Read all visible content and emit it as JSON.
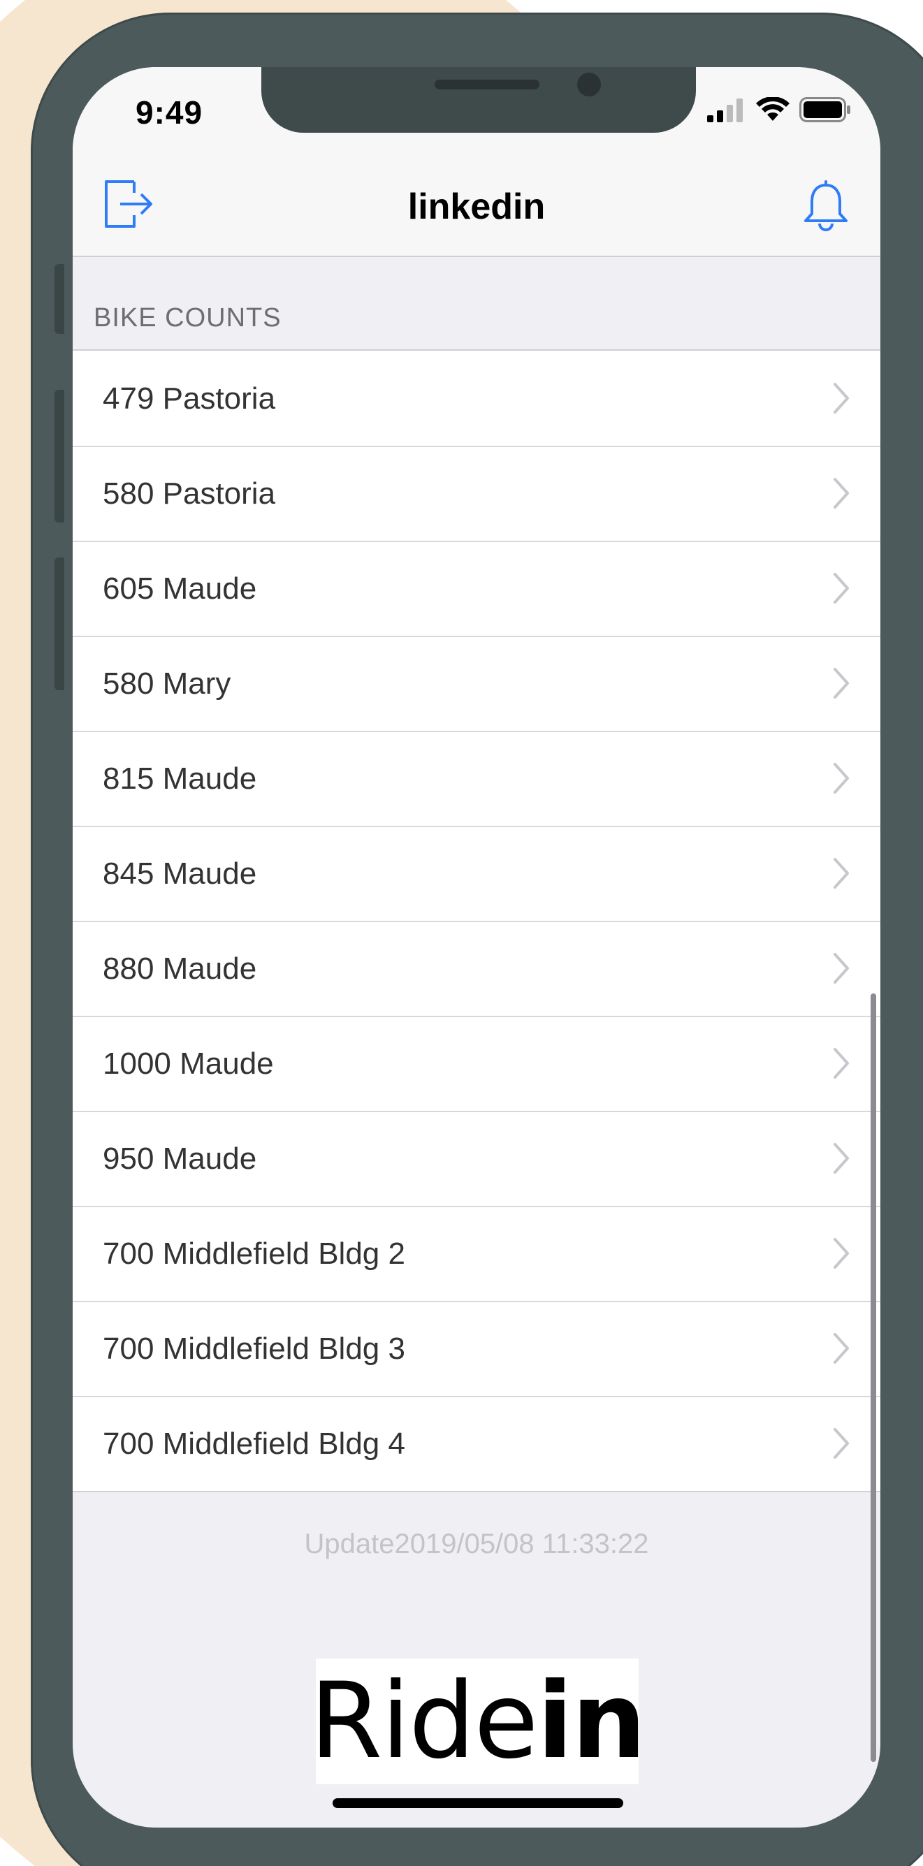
{
  "status_bar": {
    "time": "9:49",
    "icons": [
      "cellular-signal-icon",
      "wifi-icon",
      "battery-icon"
    ]
  },
  "nav": {
    "title": "linkedin",
    "left_icon": "logout-icon",
    "right_icon": "bell-icon",
    "accent_color": "#2f7cf6"
  },
  "section": {
    "header": "BIKE COUNTS"
  },
  "rows": [
    {
      "label": "479 Pastoria"
    },
    {
      "label": "580 Pastoria"
    },
    {
      "label": "605 Maude"
    },
    {
      "label": "580 Mary"
    },
    {
      "label": "815 Maude"
    },
    {
      "label": "845 Maude"
    },
    {
      "label": "880 Maude"
    },
    {
      "label": "1000 Maude"
    },
    {
      "label": "950 Maude"
    },
    {
      "label": "700 Middlefield Bldg 2"
    },
    {
      "label": "700 Middlefield Bldg 3"
    },
    {
      "label": "700 Middlefield Bldg 4"
    }
  ],
  "footer": {
    "updated": "Update2019/05/08 11:33:22",
    "logo_text_regular": "Ride",
    "logo_text_bold": "in"
  }
}
